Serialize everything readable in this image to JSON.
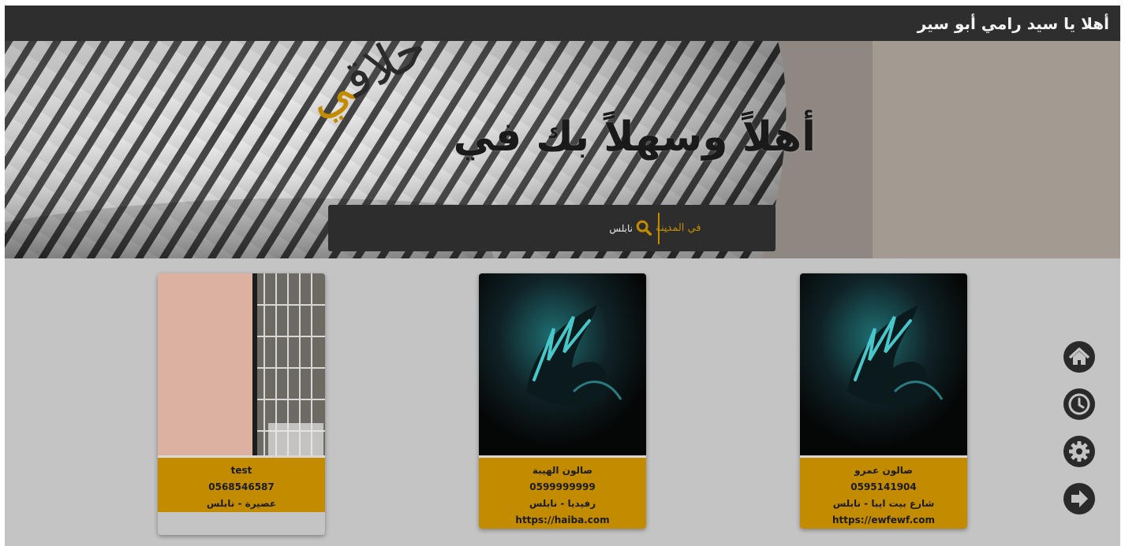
{
  "header": {
    "greeting": "أهلا يا سيد رامي أبو سير"
  },
  "hero": {
    "title": "أهلاً وسهلاً بك في",
    "logo_main": "حلاق",
    "logo_accent": "ي"
  },
  "search": {
    "city_label": "في المدينة",
    "query": "نابلس"
  },
  "salons": [
    {
      "name": "صالون عمرو",
      "phone": "0595141904",
      "address": "شارع بيت ايبا - نابلس",
      "website": "https://ewfewf.com"
    },
    {
      "name": "صالون الهيبة",
      "phone": "0599999999",
      "address": "رفيديا - نابلس",
      "website": "https://haiba.com"
    },
    {
      "name": "test",
      "phone": "0568546587",
      "address": "عصيرة - نابلس",
      "website": ""
    }
  ],
  "nav": {
    "icons": [
      "home-icon",
      "history-icon",
      "settings-icon",
      "logout-icon"
    ]
  },
  "colors": {
    "accent": "#c28b00",
    "dark": "#2e2e2e",
    "background": "#c4c4c4"
  }
}
